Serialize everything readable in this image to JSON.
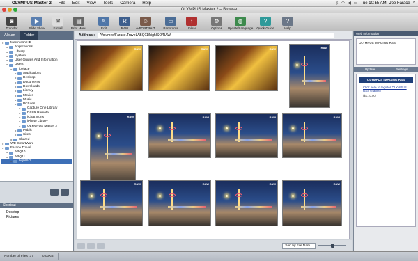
{
  "menubar": {
    "items": [
      "OLYMPUS Master 2",
      "File",
      "Edit",
      "View",
      "Tools",
      "Camera",
      "Help"
    ],
    "clock": "Tue 10:55 AM",
    "user": "Joe Farace"
  },
  "window": {
    "title": "OLYMPUS Master 2 – Browse"
  },
  "toolbar": {
    "buttons": [
      {
        "label": "Transfer"
      },
      {
        "label": "Slide Show"
      },
      {
        "label": "E-mail"
      },
      {
        "label": "Print Menu"
      },
      {
        "label": "Edit"
      },
      {
        "label": "RAW"
      },
      {
        "label": "e-PORTRAIT"
      },
      {
        "label": "Panorama"
      },
      {
        "label": "Upload"
      },
      {
        "label": "Options"
      },
      {
        "label": "Update/Language"
      },
      {
        "label": "Quick Guide"
      },
      {
        "label": "Help"
      }
    ]
  },
  "left": {
    "tabs": [
      "Album",
      "Folder"
    ],
    "tree": [
      {
        "label": "Macintosh HD",
        "depth": 0
      },
      {
        "label": "Applications",
        "depth": 1
      },
      {
        "label": "Library",
        "depth": 1
      },
      {
        "label": "System",
        "depth": 1
      },
      {
        "label": "User Guides And Information",
        "depth": 1
      },
      {
        "label": "Users",
        "depth": 1
      },
      {
        "label": "joeface",
        "depth": 2
      },
      {
        "label": "Applications",
        "depth": 3
      },
      {
        "label": "Desktop",
        "depth": 3
      },
      {
        "label": "Documents",
        "depth": 3
      },
      {
        "label": "Downloads",
        "depth": 3
      },
      {
        "label": "Library",
        "depth": 3
      },
      {
        "label": "Movies",
        "depth": 3
      },
      {
        "label": "Music",
        "depth": 3
      },
      {
        "label": "Pictures",
        "depth": 3
      },
      {
        "label": "Capture One Library",
        "depth": 4
      },
      {
        "label": "DSLR Remote",
        "depth": 4
      },
      {
        "label": "iChat Icons",
        "depth": 4
      },
      {
        "label": "iPhoto Library",
        "depth": 4
      },
      {
        "label": "OLYMPUS Master 2",
        "depth": 4
      },
      {
        "label": "Public",
        "depth": 3
      },
      {
        "label": "Sites",
        "depth": 3
      },
      {
        "label": "Shared",
        "depth": 2
      },
      {
        "label": "WD SmartWare",
        "depth": 0
      },
      {
        "label": "Farace.Travel",
        "depth": 0
      },
      {
        "label": "ABQ10",
        "depth": 1
      },
      {
        "label": "ABQ11",
        "depth": 1
      },
      {
        "label": "highISO",
        "depth": 2,
        "selected": true
      }
    ],
    "shortcut_title": "Shortcut",
    "shortcuts": [
      "Desktop",
      "Pictures"
    ]
  },
  "address": {
    "label": "Address :",
    "value": "/Volumes/Farace.Travel/ABQ11/highISO/RAW"
  },
  "thumbnails": {
    "badge": "RAW"
  },
  "footer": {
    "sort_label": "Sort by File Nam..."
  },
  "right": {
    "header": "Web Information",
    "logo_text": "OLYMPUS IMAGING RSS",
    "tabs": [
      "Update",
      "Settings"
    ],
    "rss_title": "OLYMPUS IMAGING RSS",
    "rss_link": "Click here to register OLYMPUS RSS channel",
    "rss_size": "($1.10.00)"
  },
  "status": {
    "files": "Number of Files :37",
    "size": "0.00KB"
  },
  "colors": {
    "accent": "#3d6fb7",
    "panel": "#5f6f85"
  }
}
